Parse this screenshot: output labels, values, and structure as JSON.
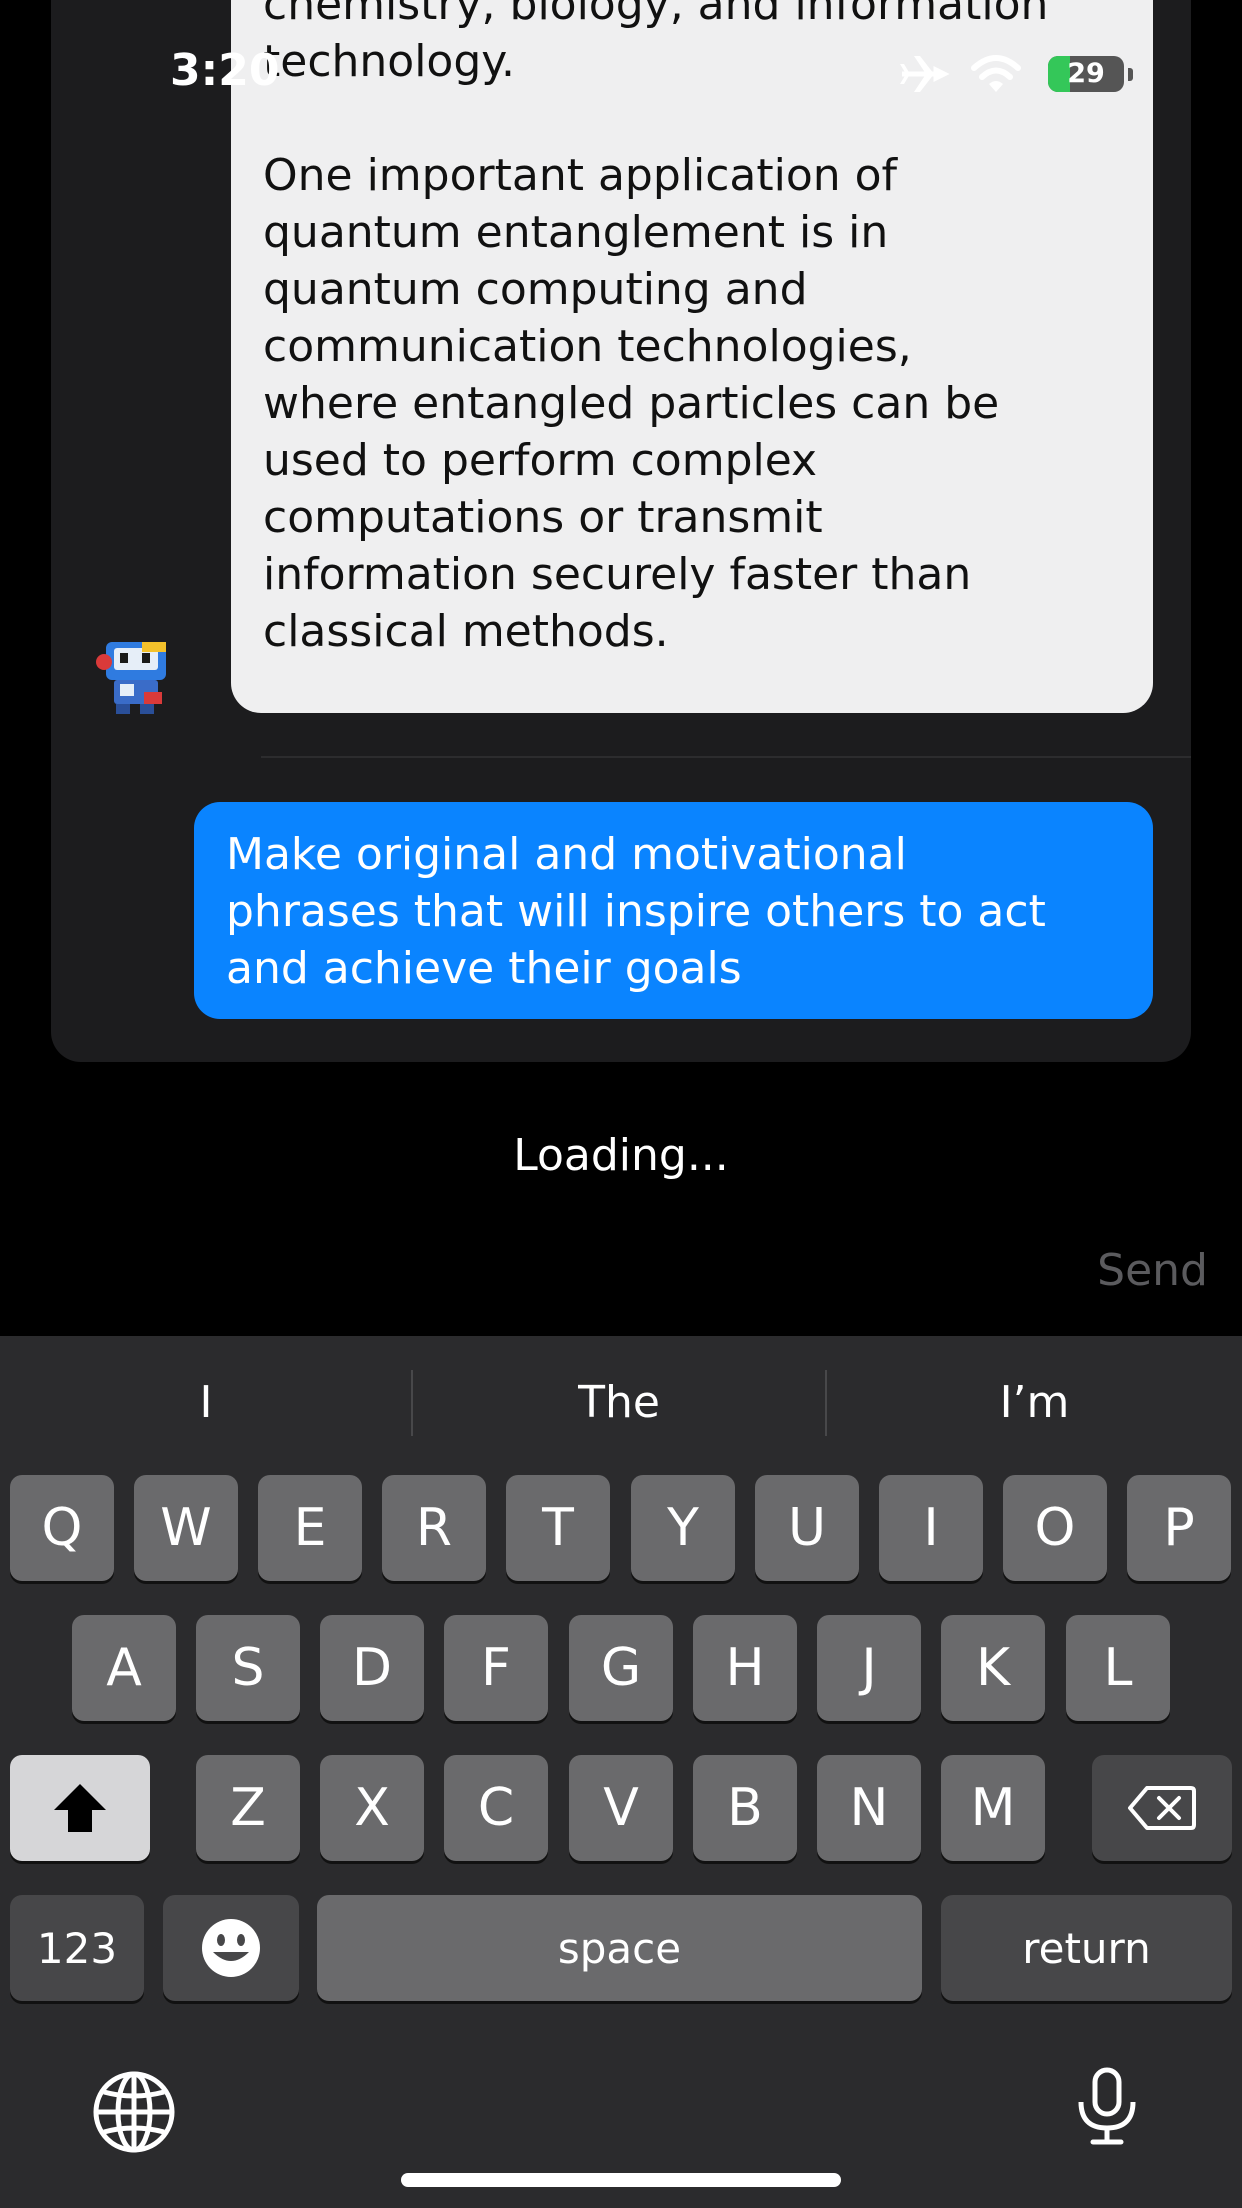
{
  "status_bar": {
    "time": "3:20",
    "battery": "29",
    "battery_level": 0.29
  },
  "bot_message": {
    "paragraph1": "chemistry, biology, and information\ntechnology.",
    "paragraph2": "One important application of\nquantum entanglement is in\nquantum computing and\ncommunication technologies,\nwhere entangled particles can be\nused to perform complex\ncomputations or transmit\ninformation securely faster than\nclassical methods."
  },
  "user_message": "Make original and motivational\nphrases that will inspire others to act\nand achieve their goals",
  "loading_text": "Loading...",
  "send_label": "Send",
  "keyboard": {
    "suggestions": [
      "I",
      "The",
      "I’m"
    ],
    "row1": [
      "Q",
      "W",
      "E",
      "R",
      "T",
      "Y",
      "U",
      "I",
      "O",
      "P"
    ],
    "row2": [
      "A",
      "S",
      "D",
      "F",
      "G",
      "H",
      "J",
      "K",
      "L"
    ],
    "row3": [
      "Z",
      "X",
      "C",
      "V",
      "B",
      "N",
      "M"
    ],
    "numbers_label": "123",
    "space_label": "space",
    "return_label": "return"
  },
  "colors": {
    "accent": "#0a84ff",
    "bot_bubble": "#efeff0",
    "battery": "#34c759"
  }
}
